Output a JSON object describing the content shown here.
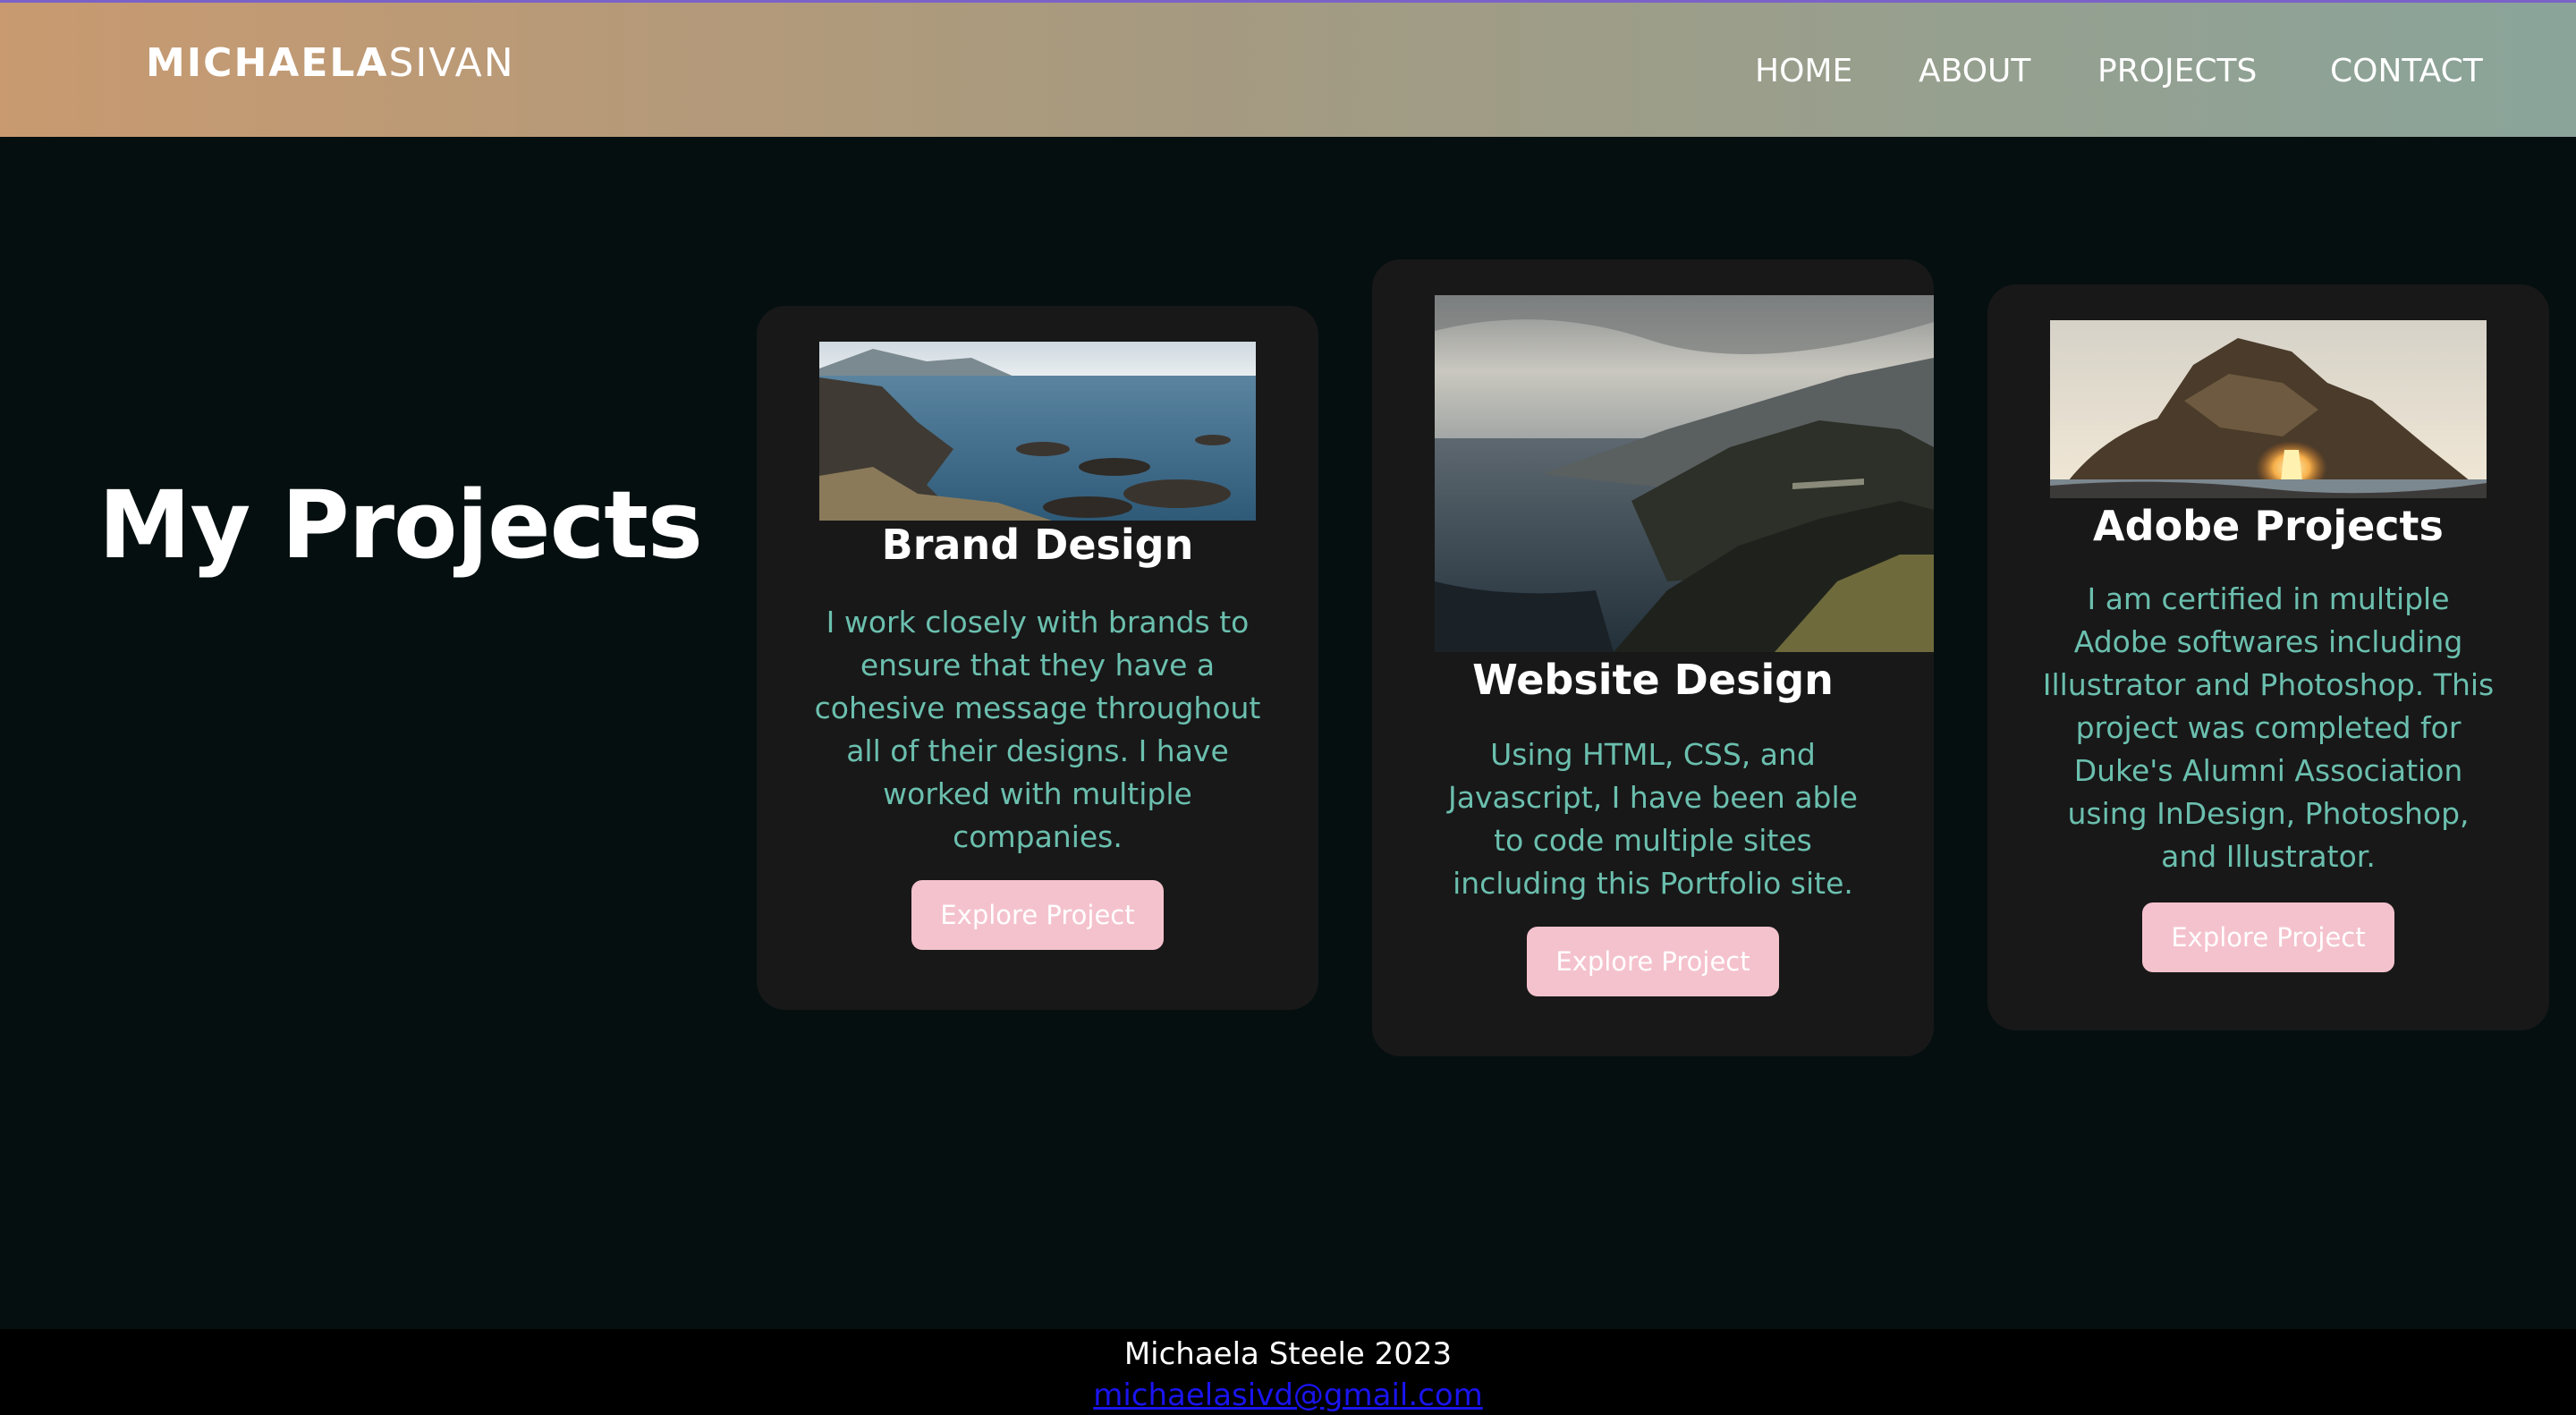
{
  "header": {
    "logo_bold": "MICHAELA",
    "logo_light": "SIVAN",
    "nav": [
      {
        "label": "HOME"
      },
      {
        "label": "ABOUT"
      },
      {
        "label": "PROJECTS"
      },
      {
        "label": "CONTACT"
      }
    ],
    "accent_color": "#7b62c8"
  },
  "main": {
    "title": "My Projects",
    "cards": [
      {
        "title": "Brand Design",
        "description": "I work closely with brands to ensure that they have a cohesive message throughout all of their designs. I have worked with multiple companies.",
        "button": "Explore Project",
        "image": "rocky-coastline-photo"
      },
      {
        "title": "Website Design",
        "description": "Using HTML, CSS, and Javascript, I have been able to code multiple sites including this Portfolio site.",
        "button": "Explore Project",
        "image": "coastal-cliffs-bridge-photo"
      },
      {
        "title": "Adobe Projects",
        "description": "I am certified in multiple Adobe softwares including Illustrator and Photoshop. This project was completed for Duke's Alumni Association using InDesign, Photoshop, and Illustrator.",
        "button": "Explore Project",
        "image": "rock-arch-sunset-photo"
      }
    ]
  },
  "footer": {
    "copyright": "Michaela Steele 2023",
    "email": "michaelasivd@gmail.com"
  },
  "colors": {
    "background": "#060f10",
    "card": "#181818",
    "description_text": "#6bbfae",
    "button": "#f4c2cd",
    "link": "#1a14ee"
  }
}
